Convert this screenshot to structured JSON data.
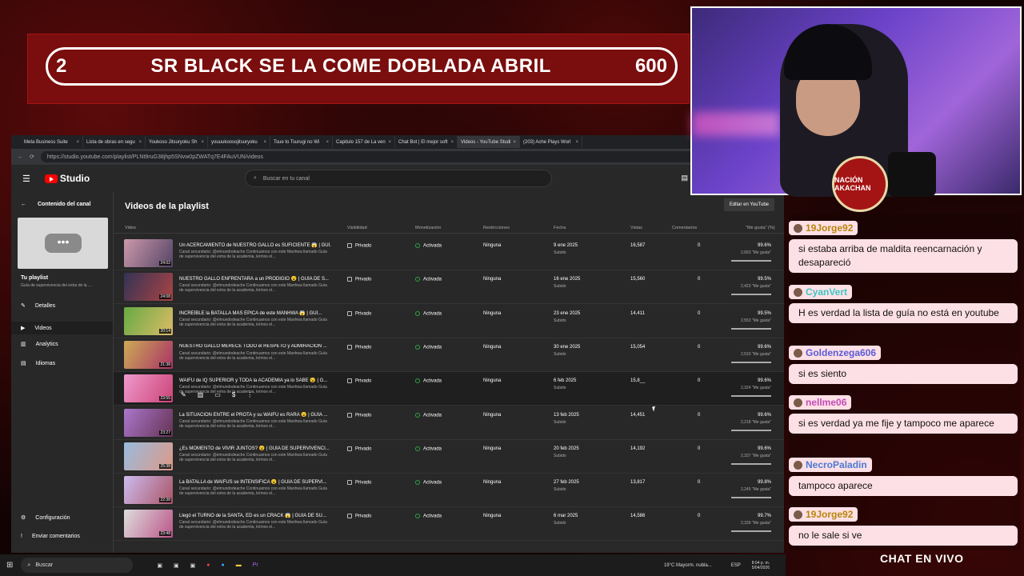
{
  "banner": {
    "left": "2",
    "title": "SR BLACK SE LA COME DOBLADA ABRIL",
    "right": "600"
  },
  "tabs": [
    "Meta Business Suite",
    "Lista de obras en segu",
    "Youkoso Jitsuryoku Sh",
    "youuukoosojitsuryoku",
    "Tsue to Tsurugi no Wi",
    "Capitulo 157 de La ven",
    "Chat Bot | El mejor soft",
    "Videos - YouTube Studi",
    "(203) Ache Plays Worl"
  ],
  "url": "https://studio.youtube.com/playlist/PLNt9ruG38jhp5SNvw0pZWATq7E4FAuVUN/videos",
  "header": {
    "studio": "Studio",
    "search_placeholder": "Buscar en tu canal"
  },
  "sidebar": {
    "back": "Contenido del canal",
    "playlist_title": "Tu playlist",
    "playlist_sub": "Guía de supervivencia del extra de la ...",
    "items": [
      "Detalles",
      "Videos",
      "Analytics",
      "Idiomas"
    ],
    "bottom": [
      "Configuración",
      "Enviar comentarios"
    ]
  },
  "main": {
    "title": "Videos de la playlist",
    "edit_button": "Editar en YouTube",
    "columns": [
      "Video",
      "Visibilidad",
      "Monetización",
      "Restricciones",
      "Fecha",
      "Vistas",
      "Comentarios",
      "\"Me gusta\" (%)"
    ],
    "desc": "Canal secundario: @elmundodeache Continuamos con este Manhwa llamado Guía de supervivencia del extra de la academia, leímos el...",
    "rows": [
      {
        "title": "Un ACERCAMIENTO de NUESTRO GALLO es SUFICIENTE 😱 | GUÍ...",
        "dur": "24:02",
        "vis": "Privado",
        "mon": "Activada",
        "res": "Ninguna",
        "date": "9 ene 2025",
        "st": "Subido",
        "views": "16,587",
        "com": "0",
        "like": "99.6%",
        "likes": "2,663 \"Me gusta\""
      },
      {
        "title": "NUESTRO GALLO ENFRENTARÁ a un PRODIGIO 😮 | GUÍA DE S...",
        "dur": "24:08",
        "vis": "Privado",
        "mon": "Activada",
        "res": "Ninguna",
        "date": "16 ene 2025",
        "st": "Subido",
        "views": "15,560",
        "com": "0",
        "like": "99.5%",
        "likes": "2,423 \"Me gusta\""
      },
      {
        "title": "INCREÍBLE la BATALLA MÁS ÉPICA de este MANHWA 😱 | GUÍ...",
        "dur": "20:14",
        "vis": "Privado",
        "mon": "Activada",
        "res": "Ninguna",
        "date": "23 ene 2025",
        "st": "Subido",
        "views": "14,411",
        "com": "0",
        "like": "99.5%",
        "likes": "2,553 \"Me gusta\""
      },
      {
        "title": "NUESTRO GALLO MERECE TODO el RESPETO y ADMIRACIÓN ...",
        "dur": "21:38",
        "vis": "Privado",
        "mon": "Activada",
        "res": "Ninguna",
        "date": "30 ene 2025",
        "st": "Subido",
        "views": "15,054",
        "com": "0",
        "like": "99.6%",
        "likes": "2,533 \"Me gusta\""
      },
      {
        "title": "WAIFU de IQ SUPERIOR y TODA la ACADEMIA ya lo SABE 😮 | G...",
        "dur": "23:55",
        "vis": "Privado",
        "mon": "Activada",
        "res": "Ninguna",
        "date": "6 feb 2025",
        "st": "Subido",
        "views": "15,8__",
        "com": "0",
        "like": "99.6%",
        "likes": "2,324 \"Me gusta\""
      },
      {
        "title": "La SITUACIÓN ENTRE el PROTA y su WAIFU es RARA 😮 | GUÍA ...",
        "dur": "23:27",
        "vis": "Privado",
        "mon": "Activada",
        "res": "Ninguna",
        "date": "13 feb 2025",
        "st": "Subido",
        "views": "14,451",
        "com": "0",
        "like": "99.6%",
        "likes": "2,218 \"Me gusta\""
      },
      {
        "title": "¿Es MOMENTO de VIVIR JUNTOS? 😮 | GUÍA DE SUPERVIVENCI...",
        "dur": "25:38",
        "vis": "Privado",
        "mon": "Activada",
        "res": "Ninguna",
        "date": "20 feb 2025",
        "st": "Subido",
        "views": "14,192",
        "com": "0",
        "like": "99.6%",
        "likes": "2,337 \"Me gusta\""
      },
      {
        "title": "La BATALLA de WAIFUS se INTENSIFICA 😮 | GUÍA DE SUPERVI...",
        "dur": "22:38",
        "vis": "Privado",
        "mon": "Activada",
        "res": "Ninguna",
        "date": "27 feb 2025",
        "st": "Subido",
        "views": "13,817",
        "com": "0",
        "like": "99.8%",
        "likes": "2,245 \"Me gusta\""
      },
      {
        "title": "Llegó el TURNO de la SANTA, ED es un CRACK 😱 | GUÍA DE SU...",
        "dur": "23:48",
        "vis": "Privado",
        "mon": "Activada",
        "res": "Ninguna",
        "date": "6 mar 2025",
        "st": "Subido",
        "views": "14,586",
        "com": "0",
        "like": "99.7%",
        "likes": "2,339 \"Me gusta\""
      }
    ]
  },
  "taskbar": {
    "search": "Buscar",
    "weather": "19°C Mayorm. nubla...",
    "lang": "ESP",
    "time": "8:04 p. m.",
    "date": "5/04/2026"
  },
  "stream": {
    "emblem": "NACIÓN AKACHAN",
    "chat_label": "CHAT EN VIVO"
  },
  "chat": [
    {
      "user": "19Jorge92",
      "color": "#b8860b",
      "text": "si estaba arriba de maldita reencarnación y desapareció"
    },
    {
      "user": "CyanVert",
      "color": "#3cc7c7",
      "text": "H es verdad la lista de guía no está en youtube"
    },
    {
      "user": "Goldenzega606",
      "color": "#5b5bd6",
      "text": "si es siento"
    },
    {
      "user": "nellme06",
      "color": "#c24ab8",
      "text": "si es verdad ya me fije y tampoco me aparece"
    },
    {
      "user": "NecroPaladin",
      "color": "#4a7ad6",
      "text": "tampoco aparece"
    },
    {
      "user": "19Jorge92",
      "color": "#b8860b",
      "text": "no le sale si ve"
    }
  ]
}
